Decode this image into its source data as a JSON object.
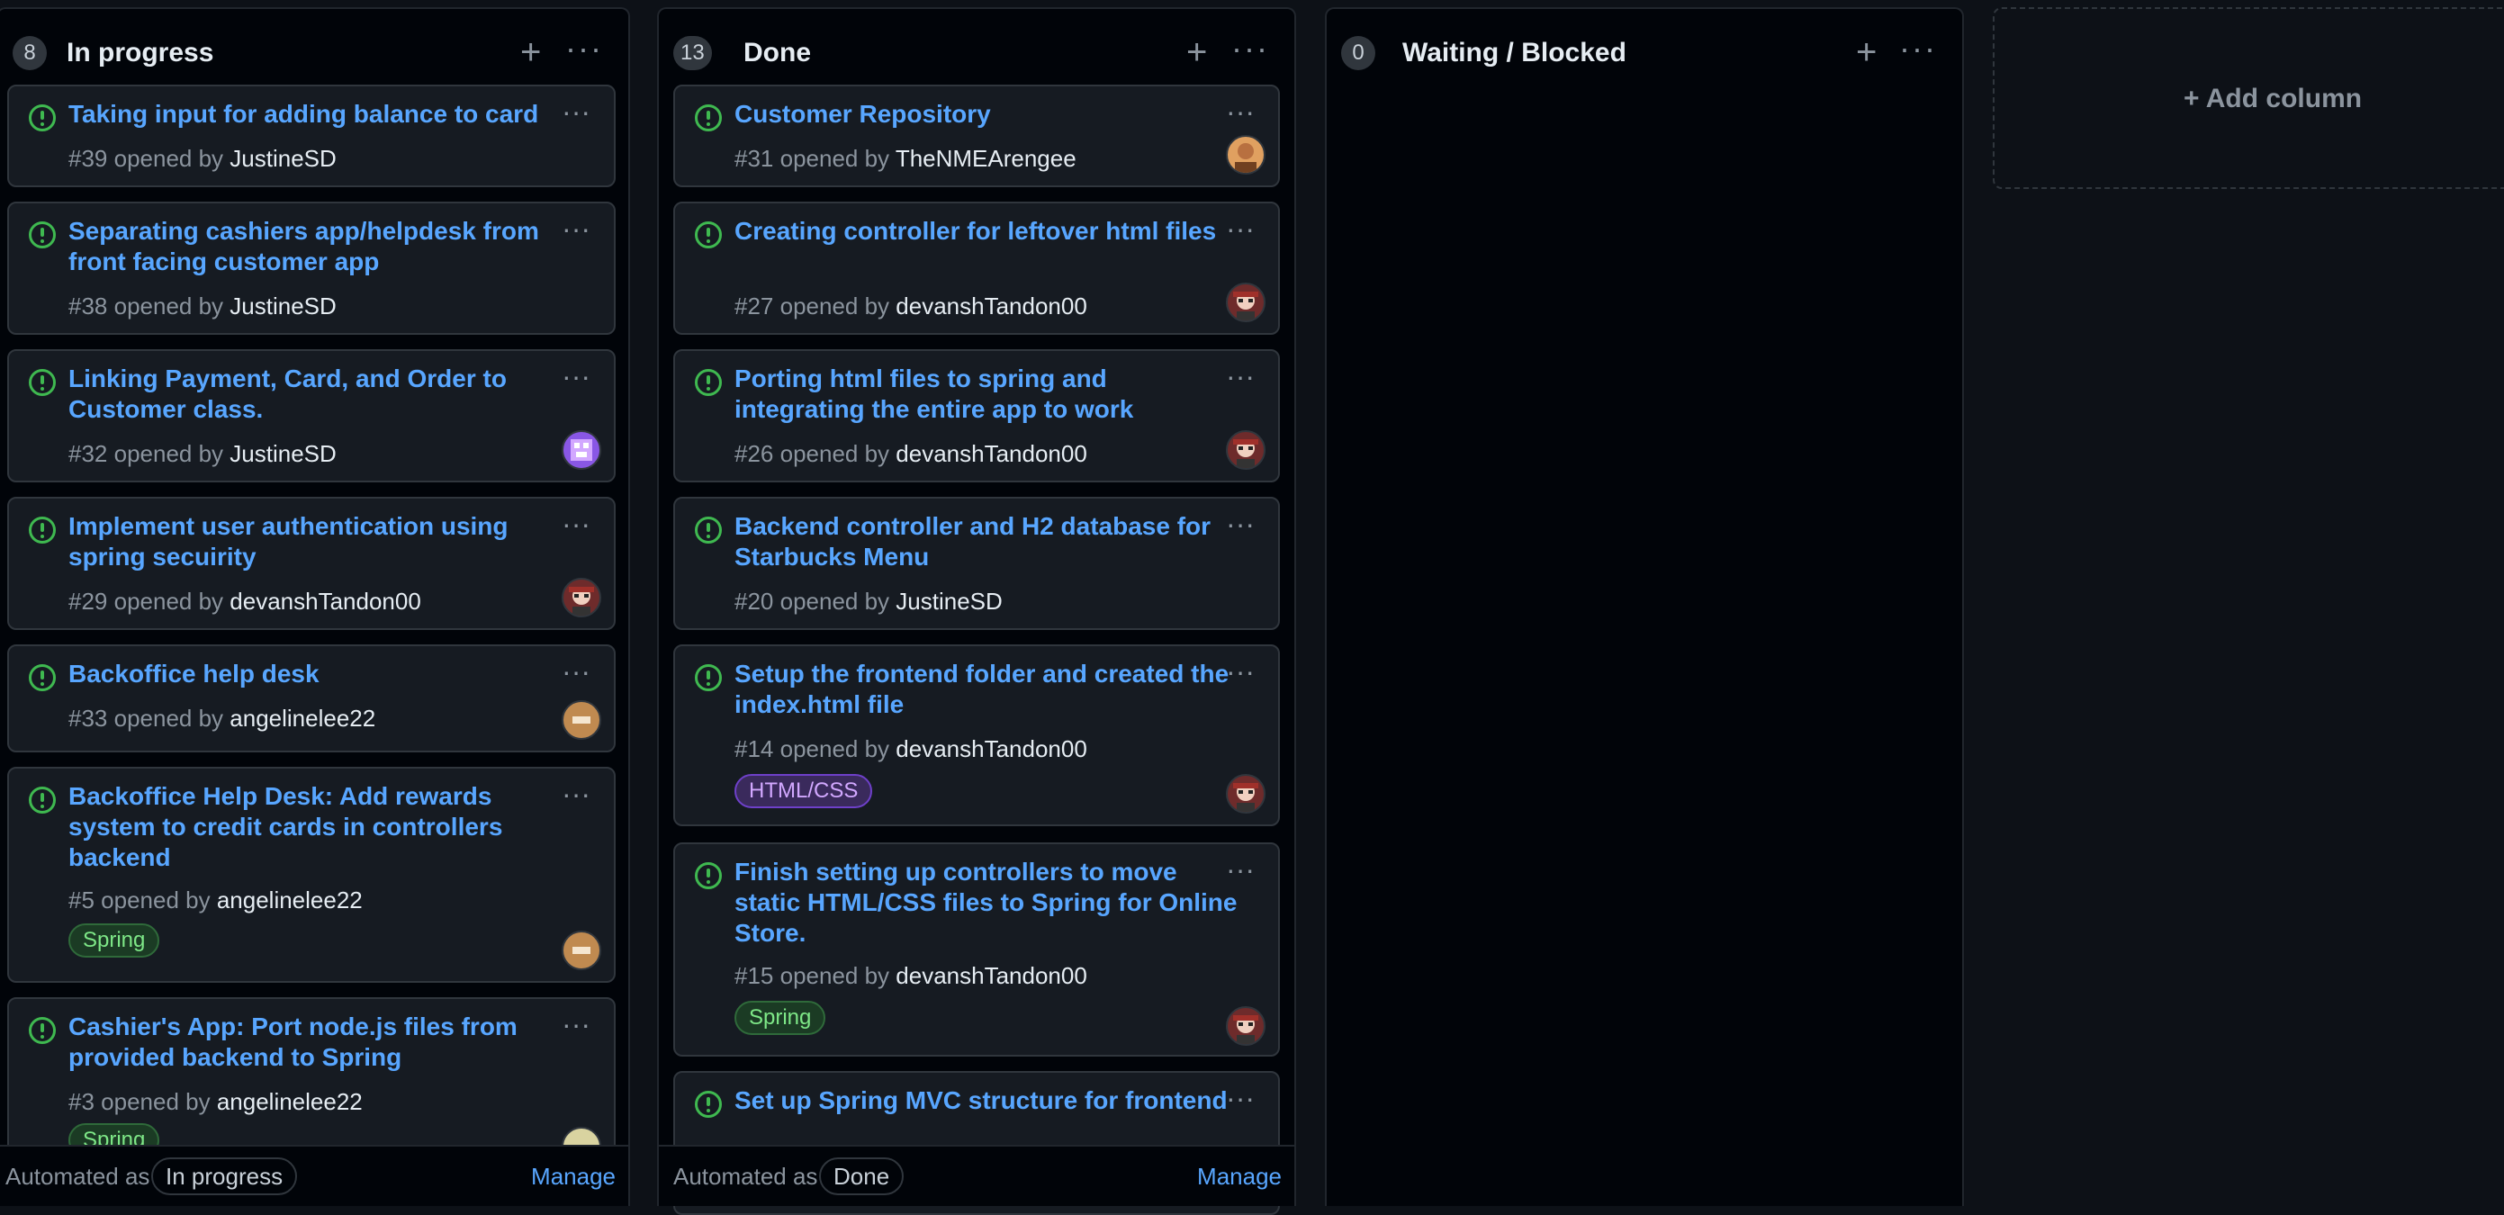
{
  "columns": {
    "in_progress": {
      "count": "8",
      "title": "In progress",
      "automated_as_label": "Automated as",
      "automation_pill": "In progress",
      "manage": "Manage",
      "cards": [
        {
          "title": "Taking input for adding balance to card",
          "number": "#39 opened by",
          "author": "JustineSD",
          "labels": []
        },
        {
          "title": "Separating cashiers app/helpdesk from front facing customer app",
          "number": "#38 opened by",
          "author": "JustineSD",
          "labels": []
        },
        {
          "title": "Linking Payment, Card, and Order to Customer class.",
          "number": "#32 opened by",
          "author": "JustineSD",
          "labels": []
        },
        {
          "title": "Implement user authentication using spring secuirity",
          "number": "#29 opened by",
          "author": "devanshTandon00",
          "labels": []
        },
        {
          "title": "Backoffice help desk",
          "number": "#33 opened by",
          "author": "angelinelee22",
          "labels": []
        },
        {
          "title": "Backoffice Help Desk: Add rewards system to credit cards in controllers backend",
          "number": "#5 opened by",
          "author": "angelinelee22",
          "labels": [
            "Spring"
          ]
        },
        {
          "title": "Cashier's App: Port node.js files from provided backend to Spring",
          "number": "#3 opened by",
          "author": "angelinelee22",
          "labels": [
            "Spring"
          ]
        }
      ]
    },
    "done": {
      "count": "13",
      "title": "Done",
      "automated_as_label": "Automated as",
      "automation_pill": "Done",
      "manage": "Manage",
      "cards": [
        {
          "title": "Customer Repository",
          "number": "#31 opened by",
          "author": "TheNMEArengee",
          "labels": []
        },
        {
          "title": "Creating controller for leftover html files",
          "number": "#27 opened by",
          "author": "devanshTandon00",
          "labels": []
        },
        {
          "title": "Porting html files to spring and integrating the entire app to work",
          "number": "#26 opened by",
          "author": "devanshTandon00",
          "labels": []
        },
        {
          "title": "Backend controller and H2 database for Starbucks Menu",
          "number": "#20 opened by",
          "author": "JustineSD",
          "labels": []
        },
        {
          "title": "Setup the frontend folder and created the index.html file",
          "number": "#14 opened by",
          "author": "devanshTandon00",
          "labels": [
            "HTML/CSS"
          ]
        },
        {
          "title": "Finish setting up controllers to move static HTML/CSS files to Spring for Online Store.",
          "number": "#15 opened by",
          "author": "devanshTandon00",
          "labels": [
            "Spring"
          ]
        },
        {
          "title": "Set up Spring MVC structure for frontend",
          "number": "",
          "author": "",
          "labels": []
        }
      ]
    },
    "waiting": {
      "count": "0",
      "title": "Waiting / Blocked"
    }
  },
  "add_column": "Add column",
  "icons": {
    "issue": "issue-open-icon",
    "plus": "plus-icon",
    "menu": "kebab-menu-icon"
  },
  "colors": {
    "link": "#58a6ff",
    "issue_open": "#3fb950",
    "background": "#0d1117"
  }
}
